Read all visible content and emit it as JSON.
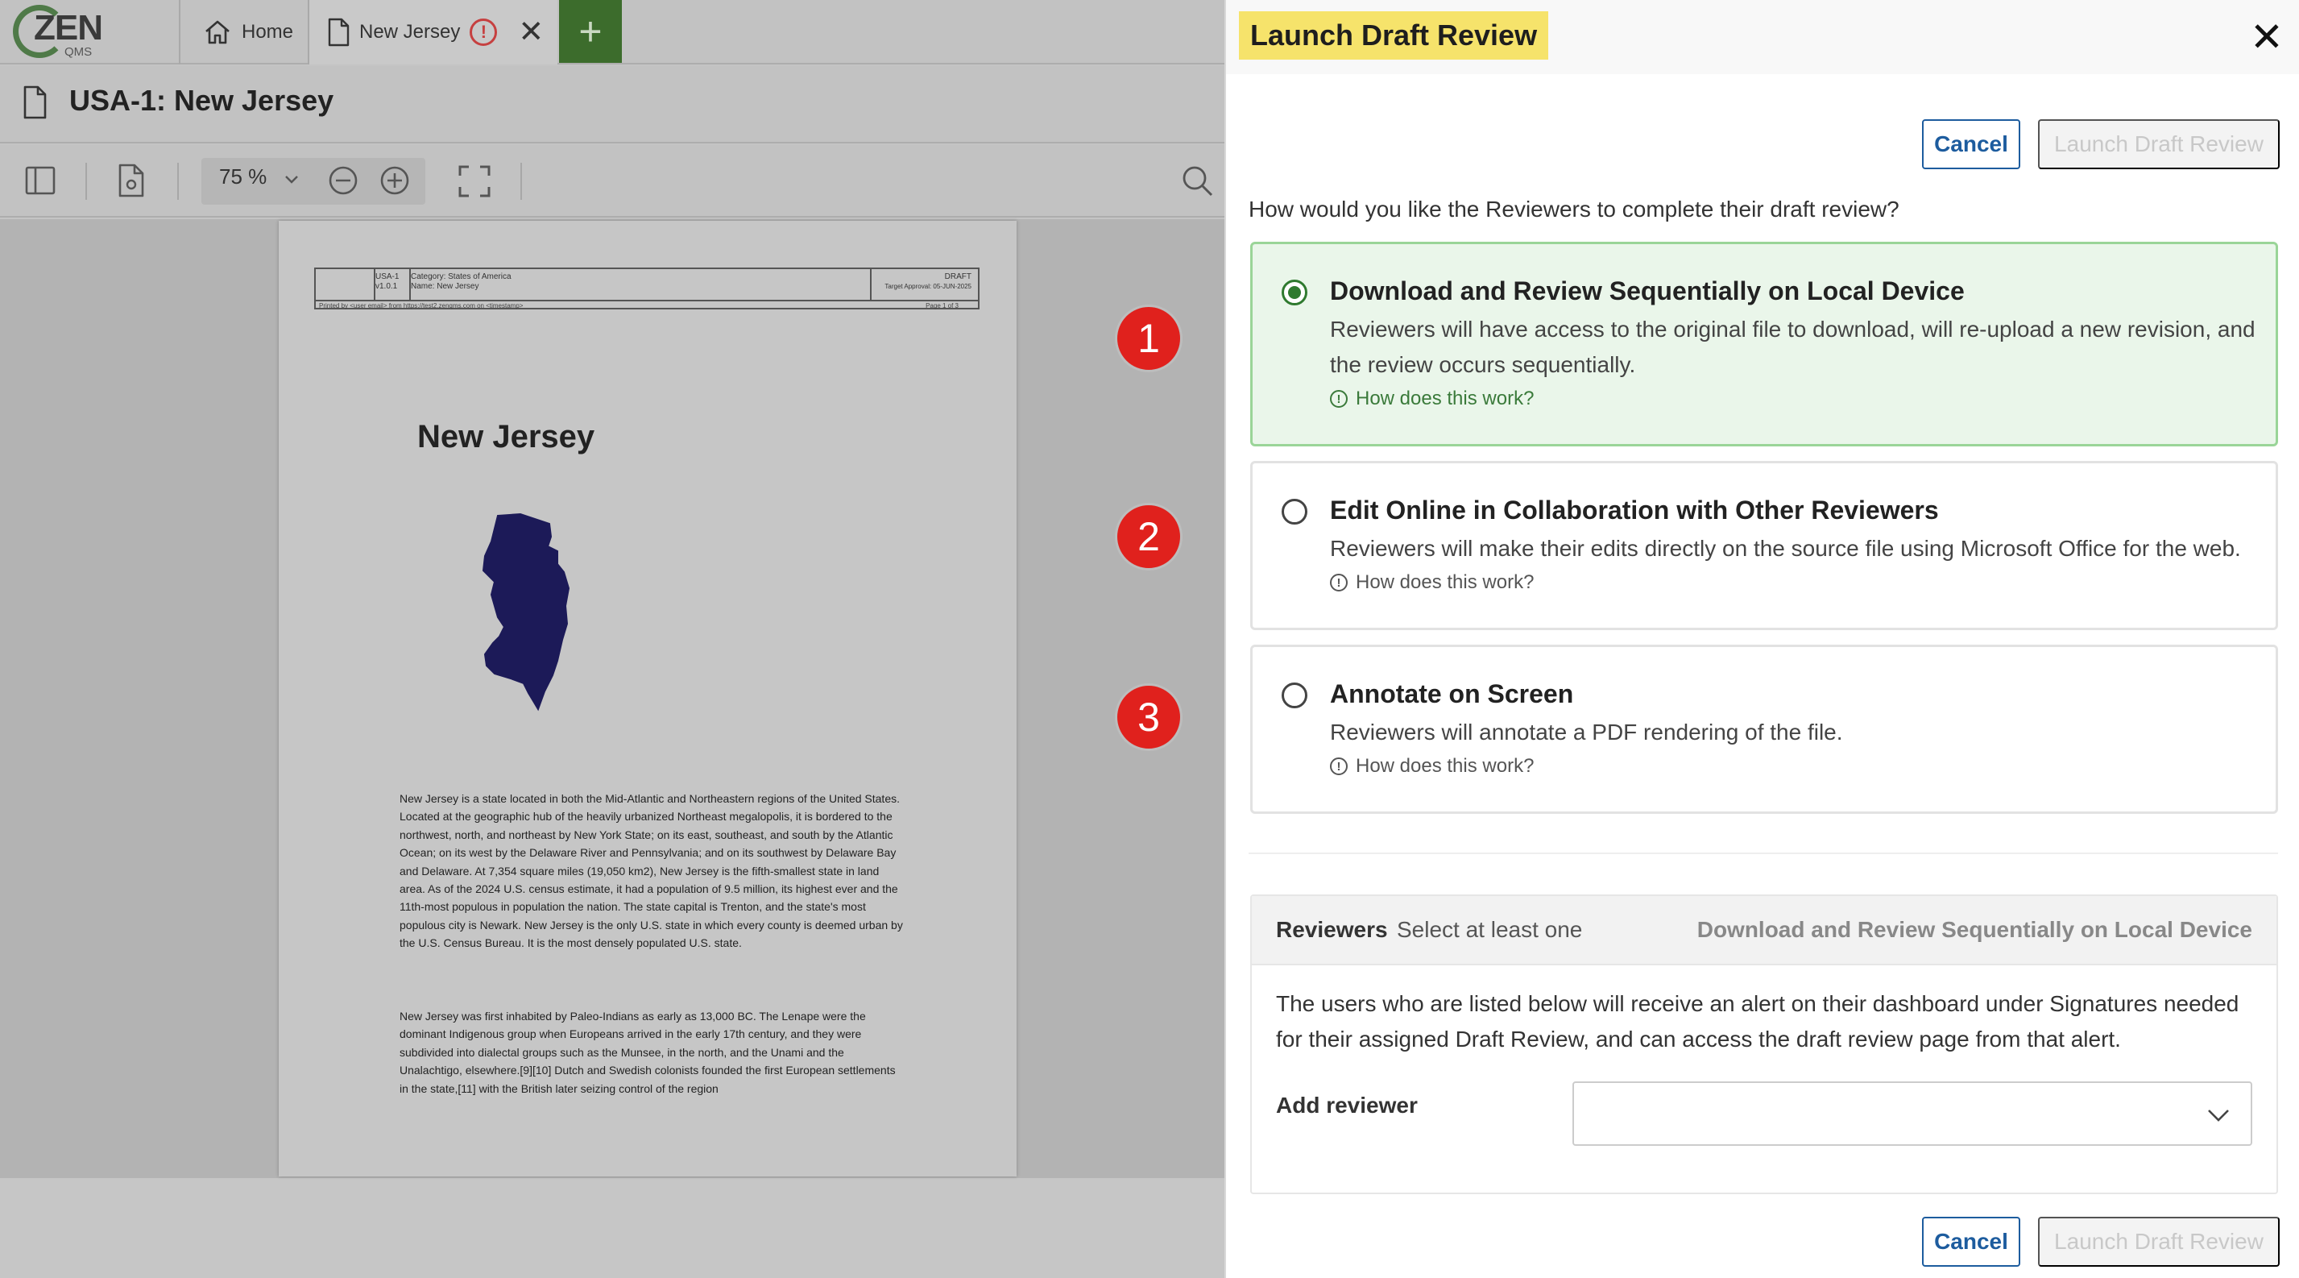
{
  "app": {
    "logo_text": "ZEN",
    "logo_sub": "QMS",
    "tabs": [
      {
        "label": "Home",
        "icon": "home-icon"
      },
      {
        "label": "New Jersey",
        "icon": "document-icon",
        "status_icon": "warning-icon",
        "status_glyph": "!"
      }
    ],
    "add_tab_glyph": "+",
    "document_title": "USA-1: New Jersey",
    "toolbar": {
      "zoom": "75 %"
    }
  },
  "document_page": {
    "header": {
      "doc_id": "USA-1",
      "version": "v1.0.1",
      "category": "Category: States of America",
      "name": "Name: New Jersey",
      "status": "DRAFT",
      "target_approval": "Target Approval: 05-JUN-2025",
      "printed_by": "Printed by <user email> from https://test2.zenqms.com on <timestamp>",
      "page": "Page 1 of 3"
    },
    "heading": "New Jersey",
    "paragraphs": [
      "New Jersey is a state located in both the Mid-Atlantic and Northeastern regions of the United States. Located at the geographic hub of the heavily urbanized Northeast megalopolis, it is bordered to the northwest, north, and northeast by New York State; on its east, southeast, and south by the Atlantic Ocean; on its west by the Delaware River and Pennsylvania; and on its southwest by Delaware Bay and Delaware. At 7,354 square miles (19,050 km2), New Jersey is the fifth-smallest state in land area. As of the 2024 U.S. census estimate, it had a population of 9.5 million, its highest ever and the 11th-most populous in population the nation. The state capital is Trenton, and the state's most populous city is Newark. New Jersey is the only U.S. state in which every county is deemed urban by the U.S. Census Bureau. It is the most densely populated U.S. state.",
      "New Jersey was first inhabited by Paleo-Indians as early as 13,000 BC. The Lenape were the dominant Indigenous group when Europeans arrived in the early 17th century, and they were subdivided into dialectal groups such as the Munsee, in the north, and the Unami and the Unalachtigo, elsewhere.[9][10] Dutch and Swedish colonists founded the first European settlements in the state,[11] with the British later seizing control of the region"
    ]
  },
  "badges": [
    "1",
    "2",
    "3"
  ],
  "drawer": {
    "title": "Launch Draft Review",
    "close_glyph": "✕",
    "cancel_label": "Cancel",
    "launch_label": "Launch Draft Review",
    "question": "How would you like the Reviewers to complete their draft review?",
    "options": [
      {
        "title": "Download and Review Sequentially on Local Device",
        "description": "Reviewers will have access to the original file to download, will re-upload a new revision, and the review occurs sequentially.",
        "help": "How does this work?",
        "selected": true
      },
      {
        "title": "Edit Online in Collaboration with Other Reviewers",
        "description": "Reviewers will make their edits directly on the source file using Microsoft Office for the web.",
        "help": "How does this work?",
        "selected": false
      },
      {
        "title": "Annotate on Screen",
        "description": "Reviewers will annotate a PDF rendering of the file.",
        "help": "How does this work?",
        "selected": false
      }
    ],
    "reviewers": {
      "label": "Reviewers",
      "hint": "Select at least one",
      "mode": "Download and Review Sequentially on Local Device",
      "info": "The users who are listed below will receive an alert on their dashboard under Signatures needed for their assigned Draft Review, and can access the draft review page from that alert.",
      "add_label": "Add reviewer",
      "add_value": ""
    }
  },
  "colors": {
    "highlight": "#f6e36b",
    "primary": "#1d5c9e",
    "selected_bg": "#eaf6ea",
    "selected_border": "#9ad598",
    "badge": "#e0211d",
    "add_tab": "#3c6c2c"
  }
}
